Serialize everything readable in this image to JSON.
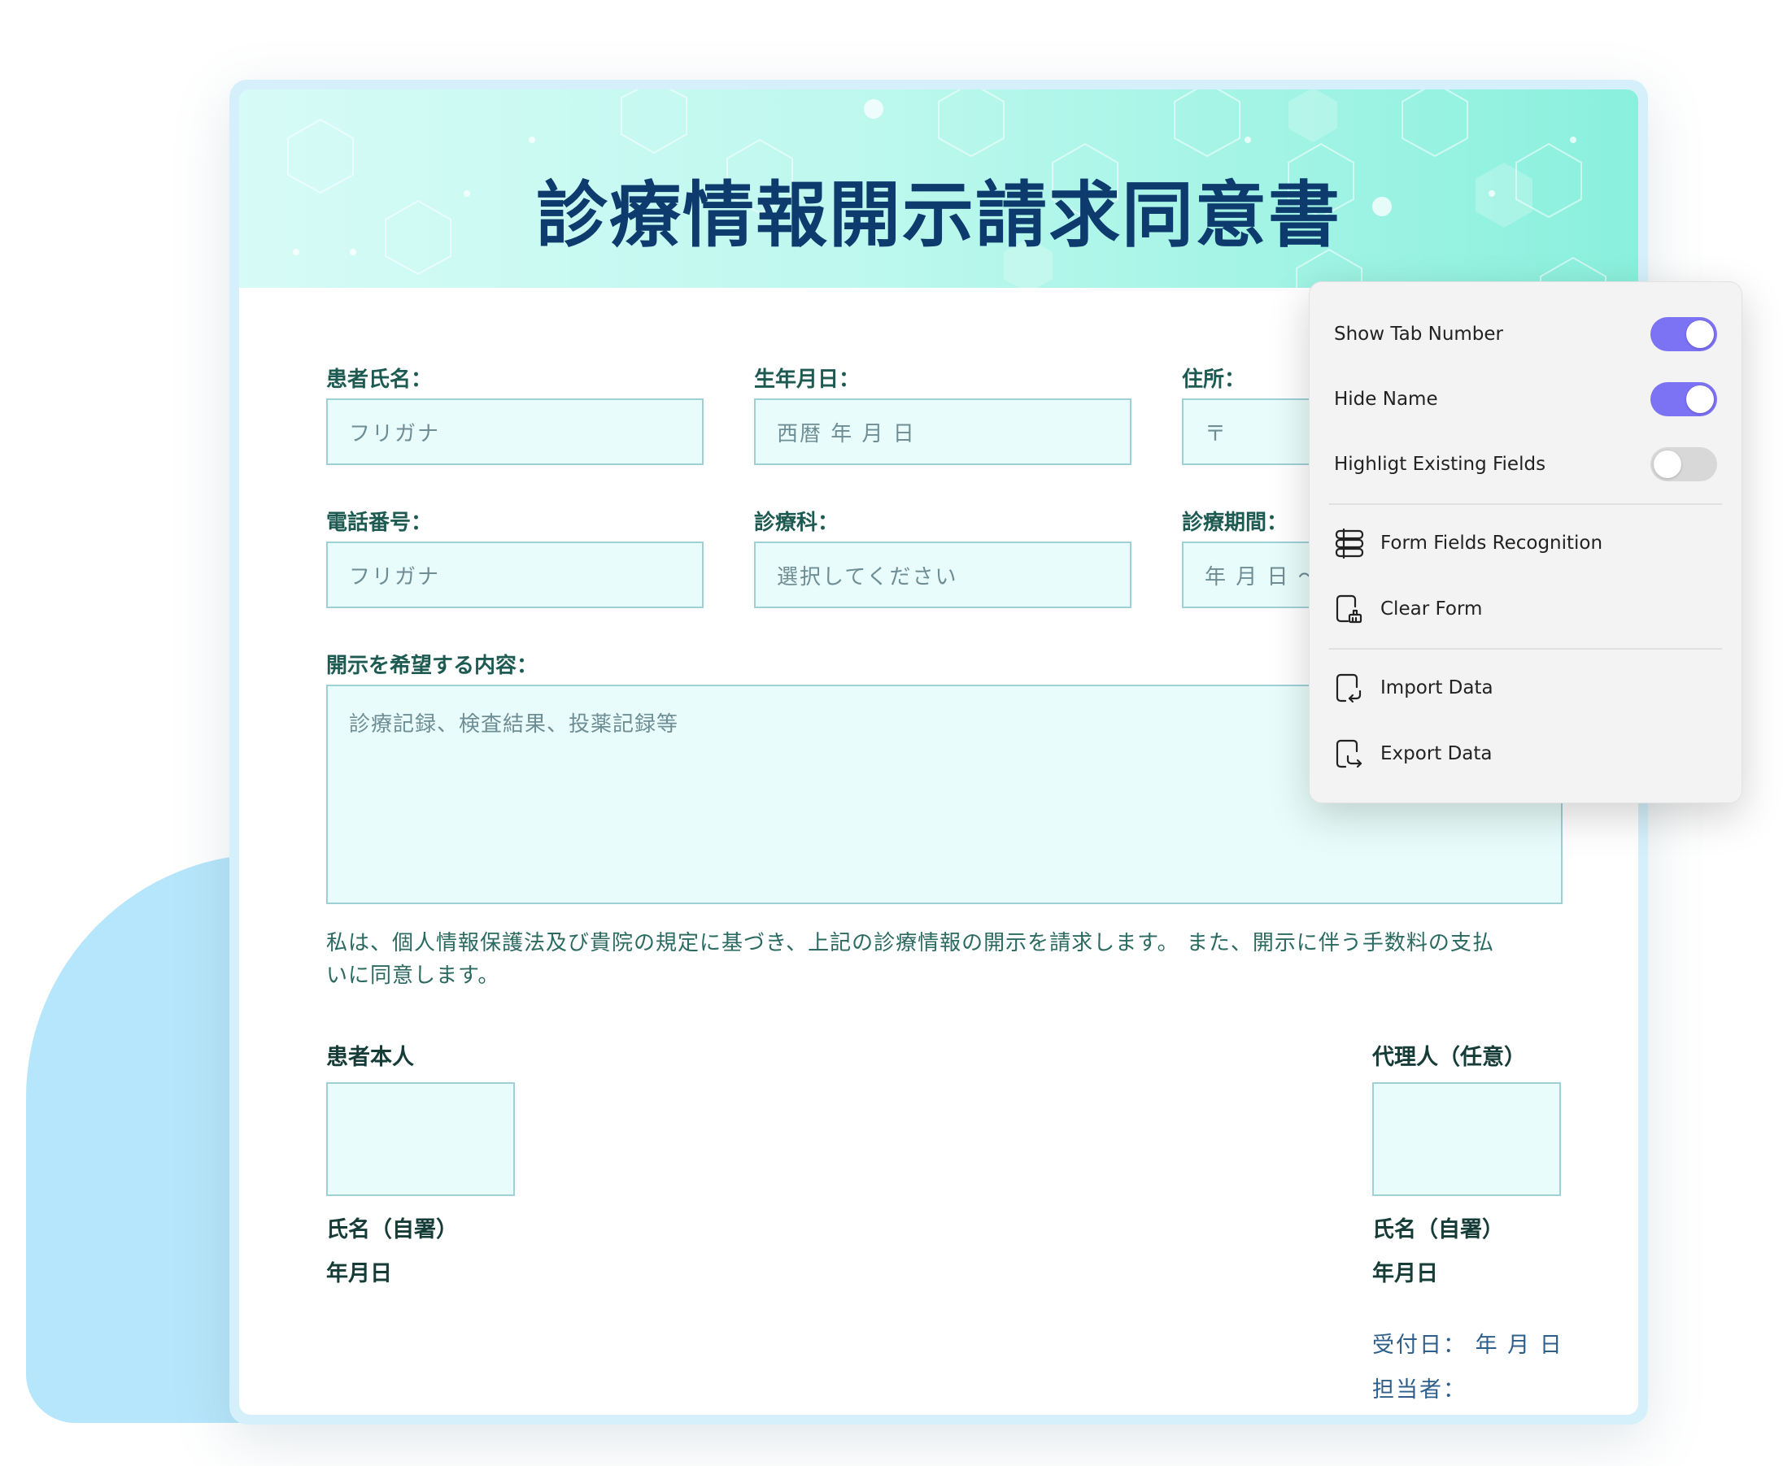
{
  "document": {
    "title": "診療情報開示請求同意書",
    "fields": {
      "patient_name": {
        "label": "患者氏名：",
        "placeholder": "フリガナ"
      },
      "birthdate": {
        "label": "生年月日：",
        "placeholder": "西暦 年 月 日"
      },
      "address": {
        "label": "住所：",
        "placeholder": "〒"
      },
      "phone": {
        "label": "電話番号：",
        "placeholder": "フリガナ"
      },
      "department": {
        "label": "診療科：",
        "placeholder": "選択してください"
      },
      "period": {
        "label": "診療期間：",
        "placeholder": "年 月 日 〜"
      },
      "disclosure": {
        "label": "開示を希望する内容：",
        "placeholder": "診療記録、検査結果、投薬記録等"
      }
    },
    "consent_line1": "私は、個人情報保護法及び貴院の規定に基づき、上記の診療情報の開示を請求します。 また、開示に伴う手数料の支払",
    "consent_line2": "いに同意します。",
    "signature": {
      "patient_heading": "患者本人",
      "agent_heading": "代理人（任意）",
      "name_label": "氏名（自署）",
      "date_label": "年月日"
    },
    "office": {
      "received": "受付日： 年 月 日",
      "staff": "担当者："
    }
  },
  "popup": {
    "toggles": [
      {
        "label": "Show Tab Number",
        "on": true
      },
      {
        "label": "Hide Name",
        "on": true
      },
      {
        "label": "Highligt Existing Fields",
        "on": false
      }
    ],
    "actions_group1": [
      {
        "label": "Form Fields Recognition",
        "icon": "form-fields-icon"
      },
      {
        "label": "Clear Form",
        "icon": "clear-form-icon"
      }
    ],
    "actions_group2": [
      {
        "label": "Import Data",
        "icon": "import-icon"
      },
      {
        "label": "Export Data",
        "icon": "export-icon"
      }
    ],
    "accent_color": "#7c72f4"
  }
}
